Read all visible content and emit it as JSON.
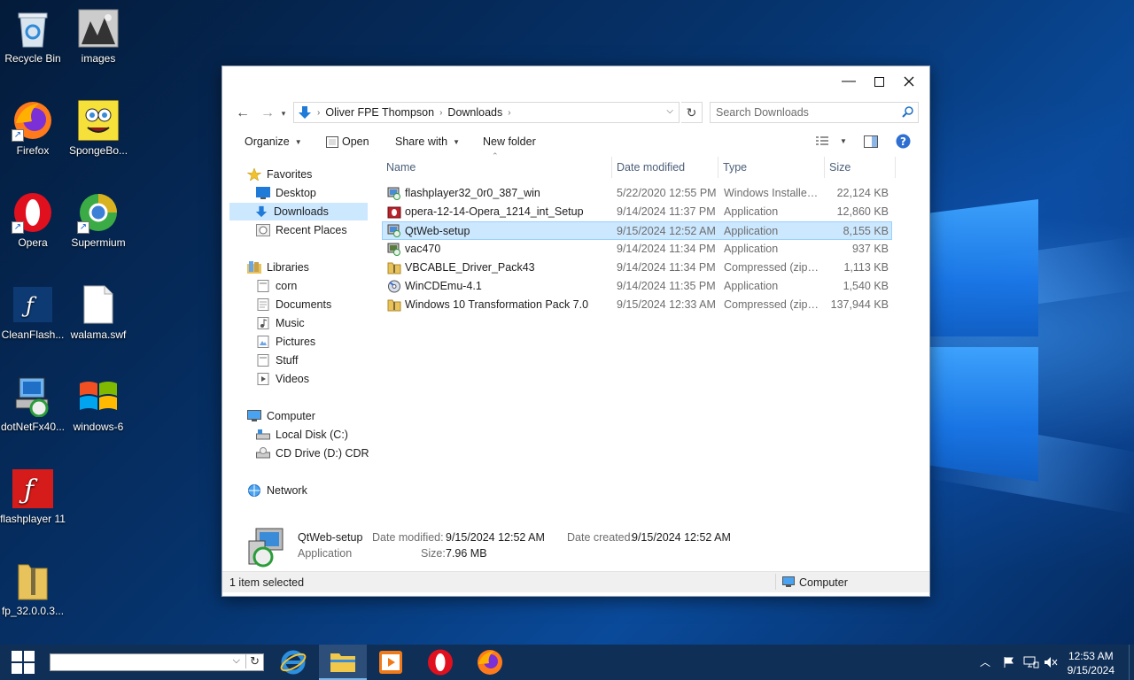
{
  "desktop": {
    "icons": [
      {
        "label": "Recycle Bin"
      },
      {
        "label": "images"
      },
      {
        "label": "Firefox"
      },
      {
        "label": "SpongeBo..."
      },
      {
        "label": "Opera"
      },
      {
        "label": "Supermium"
      },
      {
        "label": "CleanFlash..."
      },
      {
        "label": "walama.swf"
      },
      {
        "label": "dotNetFx40..."
      },
      {
        "label": "windows-6"
      },
      {
        "label": "flashplayer 11"
      },
      {
        "label": "fp_32.0.0.3..."
      }
    ]
  },
  "explorer": {
    "address": {
      "segments": [
        "Oliver FPE Thompson",
        "Downloads"
      ]
    },
    "search": {
      "placeholder": "Search Downloads"
    },
    "toolbar": {
      "organize": "Organize",
      "open": "Open",
      "share_with": "Share with",
      "new_folder": "New folder"
    },
    "nav": {
      "favorites": "Favorites",
      "desktop": "Desktop",
      "downloads": "Downloads",
      "recent_places": "Recent Places",
      "libraries": "Libraries",
      "corn": "corn",
      "documents": "Documents",
      "music": "Music",
      "pictures": "Pictures",
      "stuff": "Stuff",
      "videos": "Videos",
      "computer": "Computer",
      "local_disk": "Local Disk (C:)",
      "cd_drive": "CD Drive (D:) CDROM",
      "network": "Network"
    },
    "columns": {
      "name": "Name",
      "date": "Date modified",
      "type": "Type",
      "size": "Size"
    },
    "files": [
      {
        "name": "flashplayer32_0r0_387_win",
        "date": "5/22/2020 12:55 PM",
        "type": "Windows Installer ...",
        "size": "22,124 KB",
        "icon": "installer-icon"
      },
      {
        "name": "opera-12-14-Opera_1214_int_Setup",
        "date": "9/14/2024 11:37 PM",
        "type": "Application",
        "size": "12,860 KB",
        "icon": "opera-setup-icon"
      },
      {
        "name": "QtWeb-setup",
        "date": "9/15/2024 12:52 AM",
        "type": "Application",
        "size": "8,155 KB",
        "icon": "setup-icon"
      },
      {
        "name": "vac470",
        "date": "9/14/2024 11:34 PM",
        "type": "Application",
        "size": "937 KB",
        "icon": "setup-icon"
      },
      {
        "name": "VBCABLE_Driver_Pack43",
        "date": "9/14/2024 11:34 PM",
        "type": "Compressed (zipp...",
        "size": "1,113 KB",
        "icon": "zip-folder-icon"
      },
      {
        "name": "WinCDEmu-4.1",
        "date": "9/14/2024 11:35 PM",
        "type": "Application",
        "size": "1,540 KB",
        "icon": "disc-icon"
      },
      {
        "name": "Windows 10 Transformation Pack 7.0",
        "date": "9/15/2024 12:33 AM",
        "type": "Compressed (zipp...",
        "size": "137,944 KB",
        "icon": "zip-folder-icon"
      }
    ],
    "details": {
      "name": "QtWeb-setup",
      "kind": "Application",
      "modified_label": "Date modified:",
      "modified": "9/15/2024 12:52 AM",
      "created_label": "Date created:",
      "created": "9/15/2024 12:52 AM",
      "size_label": "Size:",
      "size": "7.96 MB"
    },
    "status": {
      "left": "1 item selected",
      "right": "Computer"
    }
  },
  "taskbar": {
    "time": "12:53 AM",
    "date": "9/15/2024"
  }
}
